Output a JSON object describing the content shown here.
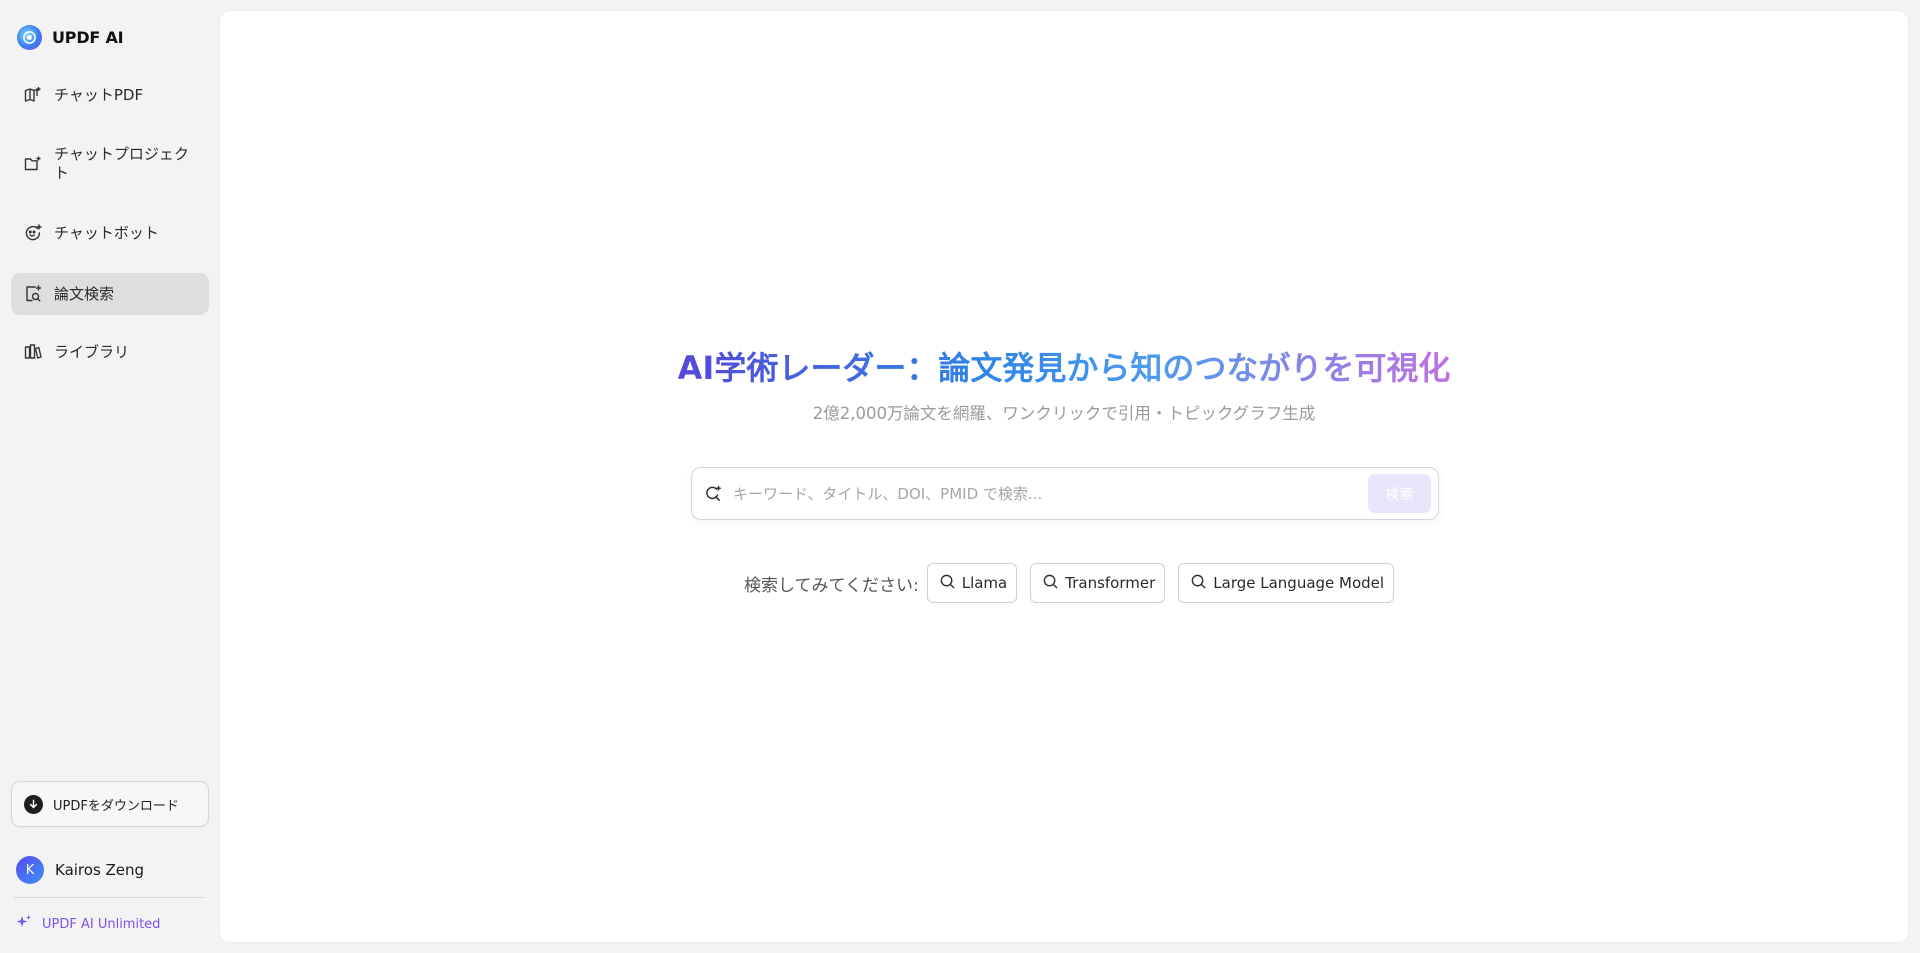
{
  "app": {
    "name": "UPDF AI"
  },
  "sidebar": {
    "items": [
      {
        "label": "チャットPDF",
        "icon": "book-icon"
      },
      {
        "label": "チャットプロジェクト",
        "icon": "folder-icon"
      },
      {
        "label": "チャットボット",
        "icon": "bot-icon"
      },
      {
        "label": "論文検索",
        "icon": "doc-search-icon",
        "active": true
      },
      {
        "label": "ライブラリ",
        "icon": "library-icon"
      }
    ],
    "download_label": "UPDFをダウンロード",
    "user": {
      "initial": "K",
      "name": "Kairos Zeng"
    },
    "plan_label": "UPDF AI Unlimited"
  },
  "main": {
    "headline": "AI学術レーダー：論文発見から知のつながりを可視化",
    "subline": "2億2,000万論文を網羅、ワンクリックで引用・トピックグラフ生成",
    "search": {
      "placeholder": "キーワード、タイトル、DOI、PMID で検索...",
      "button_label": "検索"
    },
    "suggestions": {
      "label": "検索してみてください:",
      "chips": [
        "Llama",
        "Transformer",
        "Large Language Model"
      ]
    }
  },
  "colors": {
    "accent": "#7b55e6",
    "active_nav_bg": "#dedee1",
    "search_button_bg": "#e8e6fb"
  }
}
